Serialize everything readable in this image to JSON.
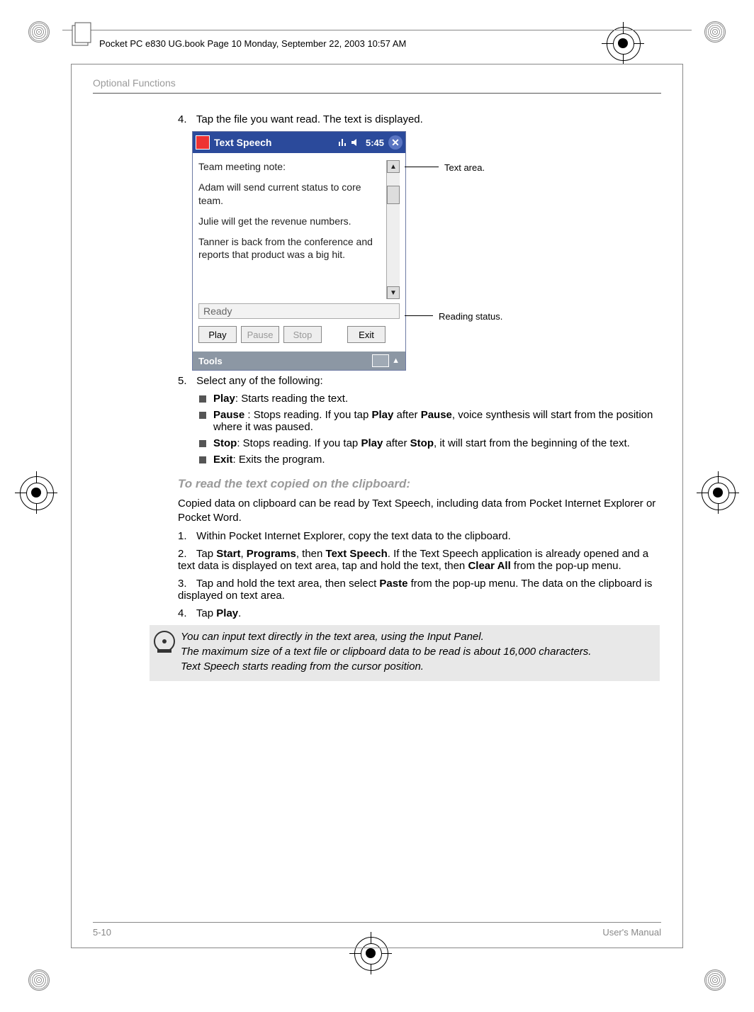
{
  "frame_header": "Pocket PC e830 UG.book  Page 10  Monday, September 22, 2003  10:57 AM",
  "section_header": "Optional Functions",
  "step4_num": "4.",
  "step4_text": "Tap the file you want read. The text is displayed.",
  "ppc": {
    "title": "Text Speech",
    "time": "5:45",
    "text_line1": "Team meeting note:",
    "text_line2": "Adam will send current status to core team.",
    "text_line3": "Julie will get the revenue numbers.",
    "text_line4": "Tanner is back from the conference and reports that product was a big hit.",
    "status": "Ready",
    "btn_play": "Play",
    "btn_pause": "Pause",
    "btn_stop": "Stop",
    "btn_exit": "Exit",
    "tools": "Tools"
  },
  "callout_textarea": "Text area.",
  "callout_status": "Reading status.",
  "step5_num": "5.",
  "step5_text": "Select any of the following:",
  "li_play_b": "Play",
  "li_play_t": ": Starts reading the text.",
  "li_pause_b": "Pause",
  "li_pause_t1": " : Stops reading. If you tap ",
  "li_pause_b2": "Play",
  "li_pause_t2": " after ",
  "li_pause_b3": "Pause",
  "li_pause_t3": ", voice synthesis will start from the position where it was paused.",
  "li_stop_b": "Stop",
  "li_stop_t1": ": Stops reading. If you tap ",
  "li_stop_b2": "Play",
  "li_stop_t2": " after ",
  "li_stop_b3": "Stop",
  "li_stop_t3": ", it will start from the beginning of the text.",
  "li_exit_b": "Exit",
  "li_exit_t": ": Exits the program.",
  "subheading": "To read the text copied on the clipboard:",
  "para_clip": "Copied data on clipboard can be read by Text Speech, including data from Pocket Internet Explorer or Pocket Word.",
  "s1_num": "1.",
  "s1_text": "Within Pocket Internet Explorer, copy the text data to the clipboard.",
  "s2_num": "2.",
  "s2_t1": "Tap ",
  "s2_b1": "Start",
  "s2_t2": ", ",
  "s2_b2": "Programs",
  "s2_t3": ", then ",
  "s2_b3": "Text Speech",
  "s2_t4": ". If the Text Speech application is already opened and a text data is displayed on text area, tap and hold the text, then ",
  "s2_b4": "Clear All",
  "s2_t5": " from the pop-up menu.",
  "s3_num": "3.",
  "s3_t1": "Tap and hold the text area, then select ",
  "s3_b1": "Paste",
  "s3_t2": " from the pop-up menu. The data on the clipboard is displayed on text area.",
  "s4_num": "4.",
  "s4_t1": "Tap ",
  "s4_b1": "Play",
  "s4_t2": ".",
  "note1": "You can input text directly in the text area, using the Input Panel.",
  "note2": "The maximum size of a text file or clipboard data to be read is about 16,000 characters.",
  "note3": "Text Speech starts reading from the cursor position.",
  "footer_left": "5-10",
  "footer_right": "User's Manual"
}
